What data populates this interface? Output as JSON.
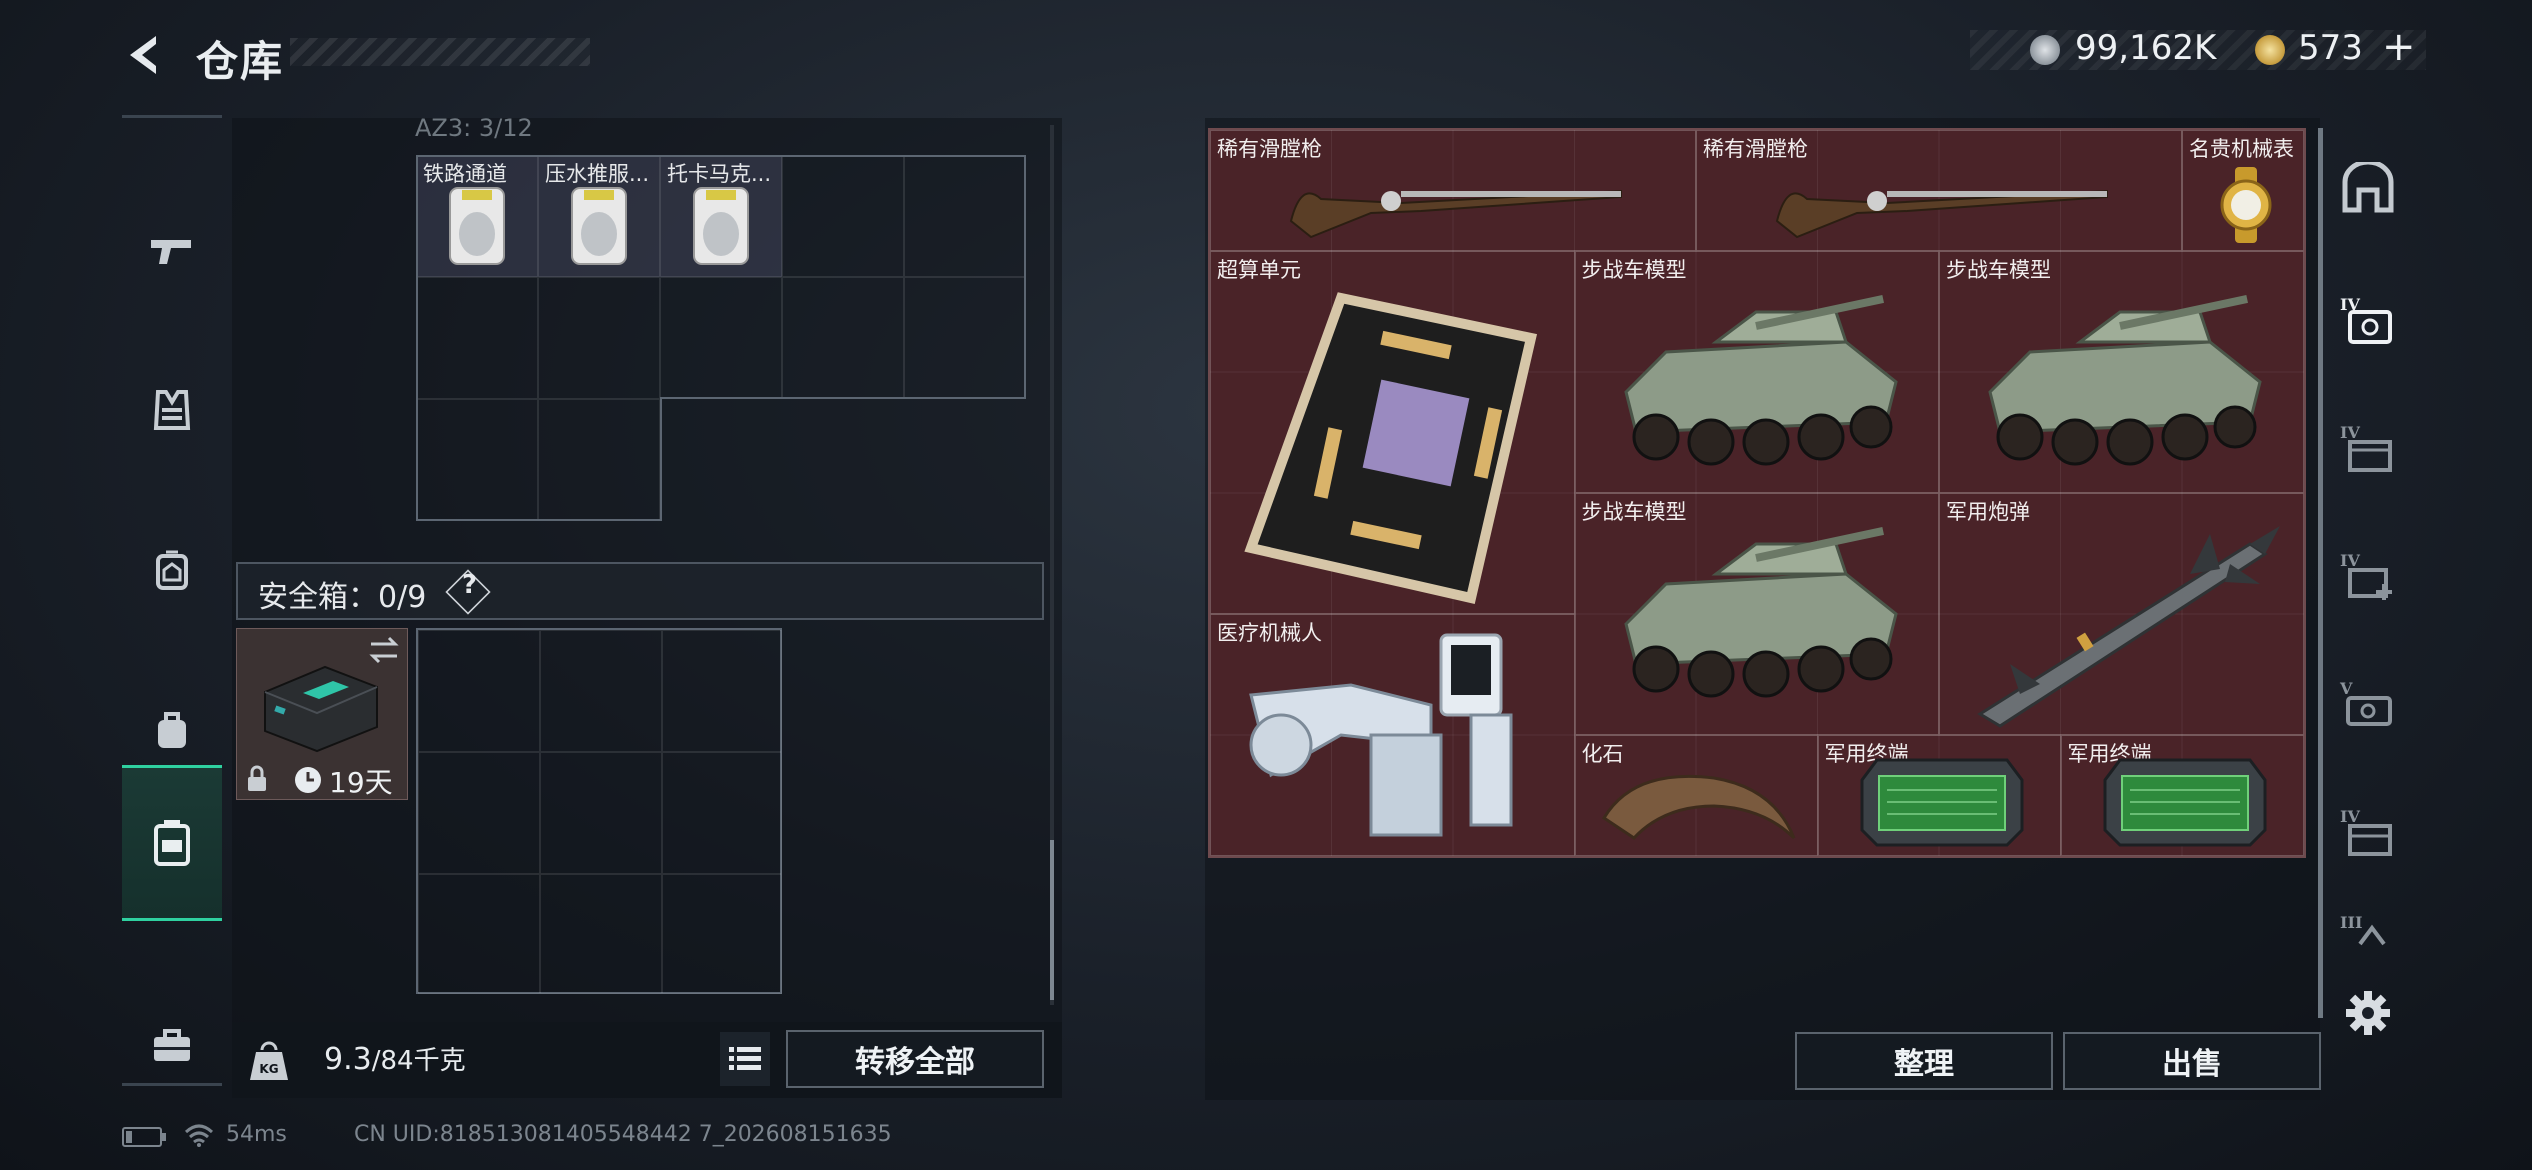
{
  "header": {
    "title": "仓库",
    "currency": [
      {
        "icon": "silver-coin-icon",
        "value": "99,162K"
      },
      {
        "icon": "gold-coin-icon",
        "value": "573"
      }
    ],
    "add_label": "+"
  },
  "left_nav": [
    "pistol-icon",
    "armor-vest-icon",
    "chest-rig-icon",
    "backpack-icon",
    "safe-box-icon",
    "toolbox-icon"
  ],
  "container": {
    "label": "AZ3: 3/12",
    "items": [
      {
        "label": "铁路通道"
      },
      {
        "label": "压水推服..."
      },
      {
        "label": "托卡马克..."
      }
    ]
  },
  "safebox": {
    "label": "安全箱：0/9",
    "help": "?",
    "card_days": "19天"
  },
  "bottom": {
    "weight_value": "9.3",
    "weight_unit": "/84千克",
    "transfer_all": "转移全部"
  },
  "loot": {
    "items": [
      {
        "label": "稀有滑膛枪",
        "icon": "musket-icon"
      },
      {
        "label": "稀有滑膛枪",
        "icon": "musket-icon"
      },
      {
        "label": "名贵机械表",
        "icon": "watch-icon"
      },
      {
        "label": "超算单元",
        "icon": "circuit-board-icon"
      },
      {
        "label": "步战车模型",
        "icon": "armored-vehicle-icon"
      },
      {
        "label": "步战车模型",
        "icon": "armored-vehicle-icon"
      },
      {
        "label": "步战车模型",
        "icon": "armored-vehicle-icon"
      },
      {
        "label": "军用炮弹",
        "icon": "missile-icon"
      },
      {
        "label": "医疗机械人",
        "icon": "medical-robot-icon"
      },
      {
        "label": "化石",
        "icon": "fossil-claw-icon"
      },
      {
        "label": "军用终端",
        "icon": "military-terminal-icon"
      },
      {
        "label": "军用终端",
        "icon": "military-terminal-icon"
      }
    ],
    "sort_label": "整理",
    "sell_label": "出售"
  },
  "right_nav": [
    "home-icon",
    "tier4-backpack-icon",
    "tier4-container-icon",
    "tier4-medkit-icon",
    "tier4-weapon-icon",
    "tier4-rig-icon",
    "tier3-armor-icon",
    "settings-gear-icon"
  ],
  "status": {
    "ping": "54ms",
    "uid": "CN UID:818513081405548442 7_202608151635"
  },
  "colors": {
    "accent": "#2fd1a0",
    "loot_bg": "#4a2328"
  }
}
